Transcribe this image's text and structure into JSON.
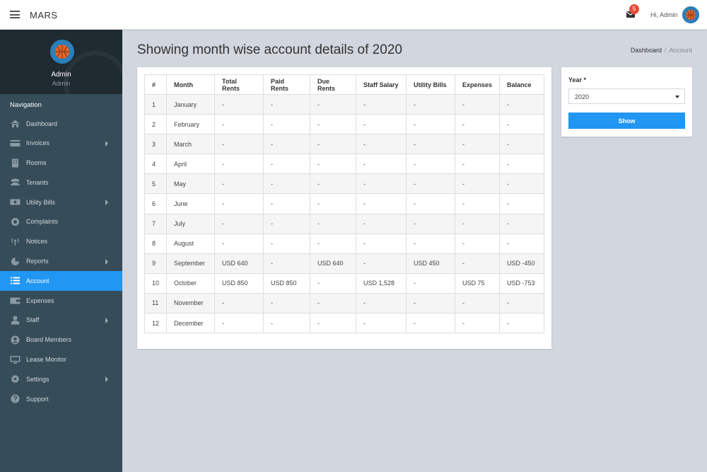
{
  "topbar": {
    "brand": "MARS",
    "notification_count": "5",
    "greeting": "Hi, Admin",
    "icons": {
      "menu": "hamburger-icon",
      "notification": "mail-bell-icon",
      "avatar": "basketball-avatar"
    }
  },
  "sidebar": {
    "profile": {
      "name": "Admin",
      "role": "Admin"
    },
    "nav_header": "Navigation",
    "items": [
      {
        "label": "Dashboard",
        "icon": "home-icon"
      },
      {
        "label": "Invoices",
        "icon": "credit-card-icon"
      },
      {
        "label": "Rooms",
        "icon": "building-icon"
      },
      {
        "label": "Tenants",
        "icon": "users-icon"
      },
      {
        "label": "Utility Bills",
        "icon": "money-icon"
      },
      {
        "label": "Complaints",
        "icon": "support-ring-icon"
      },
      {
        "label": "Notices",
        "icon": "broadcast-icon"
      },
      {
        "label": "Reports",
        "icon": "pie-chart-icon"
      },
      {
        "label": "Account",
        "icon": "list-icon"
      },
      {
        "label": "Expenses",
        "icon": "wallet-icon"
      },
      {
        "label": "Staff",
        "icon": "user-tie-icon"
      },
      {
        "label": "Board Members",
        "icon": "user-circle-icon"
      },
      {
        "label": "Lease Monitor",
        "icon": "monitor-icon"
      },
      {
        "label": "Settings",
        "icon": "gear-icon"
      },
      {
        "label": "Support",
        "icon": "question-icon"
      }
    ],
    "active_item": "Account",
    "colors": {
      "background": "#364c59",
      "active": "#2196f3"
    }
  },
  "page": {
    "title": "Showing month wise account details of 2020",
    "breadcrumb": {
      "home": "Dashboard",
      "current": "Account"
    }
  },
  "table": {
    "headers": [
      "#",
      "Month",
      "Total Rents",
      "Paid Rents",
      "Due Rents",
      "Staff Salary",
      "Utility Bills",
      "Expenses",
      "Balance"
    ],
    "rows": [
      [
        "1",
        "January",
        "-",
        "-",
        "-",
        "-",
        "-",
        "-",
        "-"
      ],
      [
        "2",
        "February",
        "-",
        "-",
        "-",
        "-",
        "-",
        "-",
        "-"
      ],
      [
        "3",
        "March",
        "-",
        "-",
        "-",
        "-",
        "-",
        "-",
        "-"
      ],
      [
        "4",
        "April",
        "-",
        "-",
        "-",
        "-",
        "-",
        "-",
        "-"
      ],
      [
        "5",
        "May",
        "-",
        "-",
        "-",
        "-",
        "-",
        "-",
        "-"
      ],
      [
        "6",
        "June",
        "-",
        "-",
        "-",
        "-",
        "-",
        "-",
        "-"
      ],
      [
        "7",
        "July",
        "-",
        "-",
        "-",
        "-",
        "-",
        "-",
        "-"
      ],
      [
        "8",
        "August",
        "-",
        "-",
        "-",
        "-",
        "-",
        "-",
        "-"
      ],
      [
        "9",
        "September",
        "USD 640",
        "-",
        "USD 640",
        "-",
        "USD 450",
        "-",
        "USD -450"
      ],
      [
        "10",
        "October",
        "USD 850",
        "USD 850",
        "-",
        "USD 1,528",
        "-",
        "USD 75",
        "USD -753"
      ],
      [
        "11",
        "November",
        "-",
        "-",
        "-",
        "-",
        "-",
        "-",
        "-"
      ],
      [
        "12",
        "December",
        "-",
        "-",
        "-",
        "-",
        "-",
        "-",
        "-"
      ]
    ]
  },
  "filter": {
    "year_label": "Year *",
    "year_value": "2020",
    "show_label": "Show",
    "button_color": "#2196f3"
  }
}
